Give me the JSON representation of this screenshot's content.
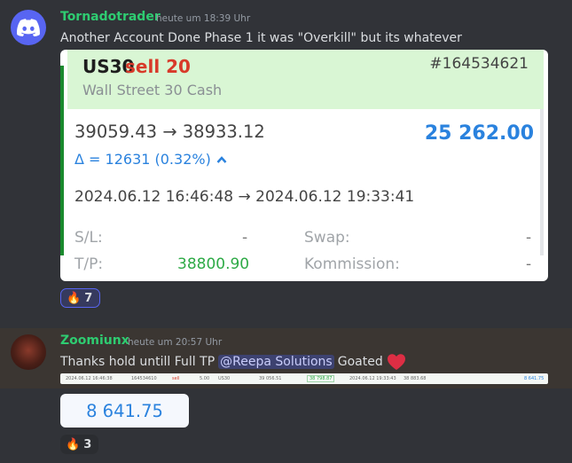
{
  "message1": {
    "author": "Tornadotrader",
    "timestamp": "heute um 18:39 Uhr",
    "text": "Another Account Done Phase 1 it was \"Overkill\" but its whatever",
    "card": {
      "ticker": "US30",
      "side": "sell 20",
      "order_id": "#164534621",
      "instrument": "Wall Street 30 Cash",
      "prices": "39059.43 → 38933.12",
      "profit": "25 262.00",
      "delta": "Δ = 12631 (0.32%)",
      "dates": "2024.06.12 16:46:48 → 2024.06.12 19:33:41",
      "sl_label": "S/L:",
      "sl_value": "-",
      "swap_label": "Swap:",
      "swap_value": "-",
      "tp_label": "T/P:",
      "tp_value": "38800.90",
      "kommission_label": "Kommission:",
      "kommission_value": "-"
    },
    "reaction": {
      "icon": "fire-icon",
      "count": "7"
    }
  },
  "message2": {
    "author": "Zoomiunx",
    "timestamp": "heute um 20:57 Uhr",
    "text_before": "Thanks hold untill Full TP",
    "mention": "@Reepa Solutions",
    "text_after": "Goated",
    "heart_icon": "heart-icon",
    "strip": {
      "open_time": "2024.06.12 16:46:38",
      "order": "164534610",
      "side": "sell",
      "volume": "5.00",
      "symbol": "US30",
      "open_price": "39 056.51",
      "tp": "38 798.87",
      "close_time": "2024.06.12 19:33:43",
      "close_price": "38 883.68",
      "profit": "8 641.75"
    },
    "profit_bubble": "8 641.75",
    "reaction": {
      "icon": "fire-icon",
      "count": "3"
    }
  },
  "colors": {
    "background": "#313338",
    "username_green": "#2ecc71",
    "profit_blue": "#2a82de",
    "sell_red": "#d83a2a",
    "tp_green": "#2eaa46"
  }
}
